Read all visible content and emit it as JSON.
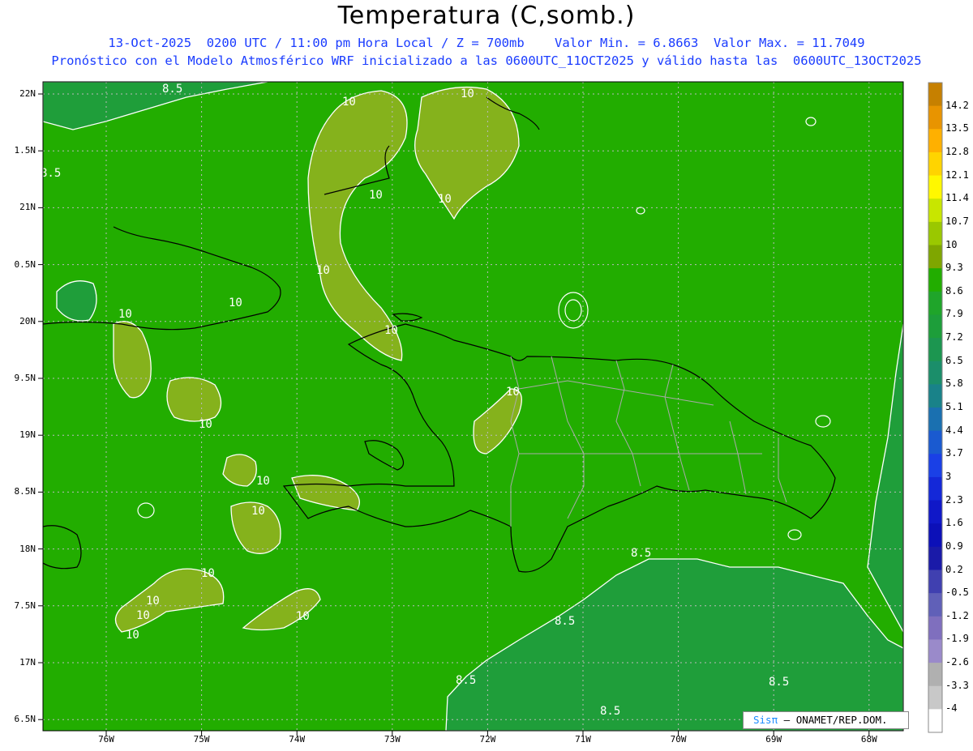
{
  "title": "Temperatura (C,somb.)",
  "subtitle_line1": "13-Oct-2025  0200 UTC / 11:00 pm Hora Local / Z = 700mb    Valor Min. = 6.8663  Valor Max. = 11.7049",
  "subtitle_line2": "Pronóstico con el Modelo Atmosférico WRF inicializado a las 0600UTC_11OCT2025 y válido hasta las  0600UTC_13OCT2025",
  "credit": {
    "logo_text": "Sisπ",
    "org": "– ONAMET/REP.DOM."
  },
  "lat_labels": [
    "22N",
    "1.5N",
    "21N",
    "0.5N",
    "20N",
    "9.5N",
    "19N",
    "8.5N",
    "18N",
    "7.5N",
    "17N",
    "6.5N"
  ],
  "lon_labels": [
    "76W",
    "75W",
    "74W",
    "73W",
    "72W",
    "71W",
    "70W",
    "69W",
    "68W"
  ],
  "colorbar": {
    "labels": [
      "14.2",
      "13.5",
      "12.8",
      "12.1",
      "11.4",
      "10.7",
      "10",
      "9.3",
      "8.6",
      "7.9",
      "7.2",
      "6.5",
      "5.8",
      "5.1",
      "4.4",
      "3.7",
      "3",
      "2.3",
      "1.6",
      "0.9",
      "0.2",
      "-0.5",
      "-1.2",
      "-1.9",
      "-2.6",
      "-3.3",
      "-4"
    ],
    "colors": [
      "#c68000",
      "#e89400",
      "#ffb000",
      "#ffd400",
      "#fff800",
      "#c8e600",
      "#9ac800",
      "#7fa600",
      "#22ad00",
      "#1fa52a",
      "#1d9e3a",
      "#1c9650",
      "#1b8e6a",
      "#198289",
      "#1a70b0",
      "#1a5ad0",
      "#1a40e6",
      "#1428d8",
      "#1018c8",
      "#0c10b8",
      "#1a1aa8",
      "#4040b0",
      "#6060b8",
      "#7f6fbe",
      "#9a8aca",
      "#b0b0b0",
      "#c8c8c8",
      "#ffffff"
    ]
  },
  "contour_labels": [
    "8.5",
    "10"
  ],
  "colors": {
    "land_warm": "#85b21c",
    "sea_green": "#22ad00",
    "cool_green": "#1f9e3a",
    "subtitle_blue": "#1a3cff"
  }
}
